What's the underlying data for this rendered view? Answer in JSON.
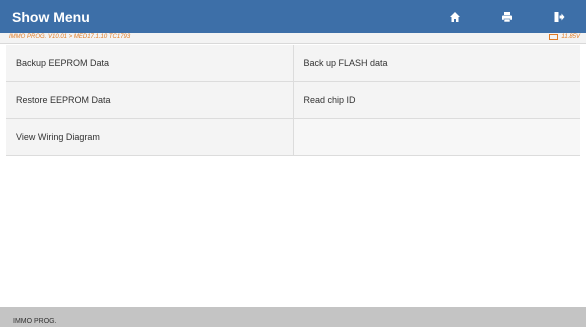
{
  "header": {
    "title": "Show Menu",
    "accent_color": "#3d6fa8",
    "buttons": [
      {
        "name": "home",
        "icon": "home-icon"
      },
      {
        "name": "print",
        "icon": "printer-icon"
      },
      {
        "name": "exit",
        "icon": "exit-icon"
      }
    ]
  },
  "infobar": {
    "path": "IMMO PROG. V10.01 > MED17.1.10 TC1793",
    "voltage": "11.85V"
  },
  "menu": {
    "items": [
      [
        "Backup EEPROM Data",
        "Back up FLASH data"
      ],
      [
        "Restore EEPROM Data",
        "Read chip ID"
      ],
      [
        "View Wiring Diagram",
        ""
      ]
    ]
  },
  "footer": {
    "label": "IMMO PROG."
  }
}
